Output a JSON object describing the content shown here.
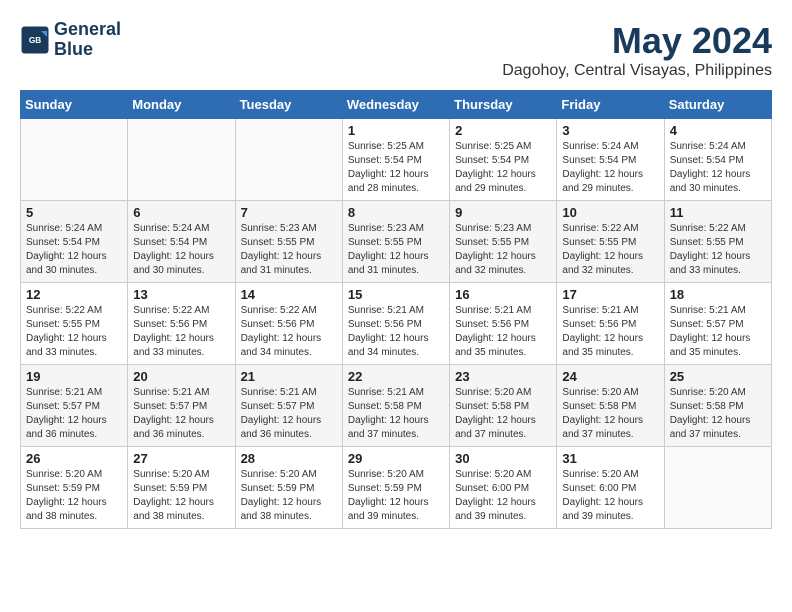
{
  "header": {
    "logo_line1": "General",
    "logo_line2": "Blue",
    "month_title": "May 2024",
    "location": "Dagohoy, Central Visayas, Philippines"
  },
  "weekdays": [
    "Sunday",
    "Monday",
    "Tuesday",
    "Wednesday",
    "Thursday",
    "Friday",
    "Saturday"
  ],
  "weeks": [
    [
      {
        "day": "",
        "sunrise": "",
        "sunset": "",
        "daylight": ""
      },
      {
        "day": "",
        "sunrise": "",
        "sunset": "",
        "daylight": ""
      },
      {
        "day": "",
        "sunrise": "",
        "sunset": "",
        "daylight": ""
      },
      {
        "day": "1",
        "sunrise": "Sunrise: 5:25 AM",
        "sunset": "Sunset: 5:54 PM",
        "daylight": "Daylight: 12 hours and 28 minutes."
      },
      {
        "day": "2",
        "sunrise": "Sunrise: 5:25 AM",
        "sunset": "Sunset: 5:54 PM",
        "daylight": "Daylight: 12 hours and 29 minutes."
      },
      {
        "day": "3",
        "sunrise": "Sunrise: 5:24 AM",
        "sunset": "Sunset: 5:54 PM",
        "daylight": "Daylight: 12 hours and 29 minutes."
      },
      {
        "day": "4",
        "sunrise": "Sunrise: 5:24 AM",
        "sunset": "Sunset: 5:54 PM",
        "daylight": "Daylight: 12 hours and 30 minutes."
      }
    ],
    [
      {
        "day": "5",
        "sunrise": "Sunrise: 5:24 AM",
        "sunset": "Sunset: 5:54 PM",
        "daylight": "Daylight: 12 hours and 30 minutes."
      },
      {
        "day": "6",
        "sunrise": "Sunrise: 5:24 AM",
        "sunset": "Sunset: 5:54 PM",
        "daylight": "Daylight: 12 hours and 30 minutes."
      },
      {
        "day": "7",
        "sunrise": "Sunrise: 5:23 AM",
        "sunset": "Sunset: 5:55 PM",
        "daylight": "Daylight: 12 hours and 31 minutes."
      },
      {
        "day": "8",
        "sunrise": "Sunrise: 5:23 AM",
        "sunset": "Sunset: 5:55 PM",
        "daylight": "Daylight: 12 hours and 31 minutes."
      },
      {
        "day": "9",
        "sunrise": "Sunrise: 5:23 AM",
        "sunset": "Sunset: 5:55 PM",
        "daylight": "Daylight: 12 hours and 32 minutes."
      },
      {
        "day": "10",
        "sunrise": "Sunrise: 5:22 AM",
        "sunset": "Sunset: 5:55 PM",
        "daylight": "Daylight: 12 hours and 32 minutes."
      },
      {
        "day": "11",
        "sunrise": "Sunrise: 5:22 AM",
        "sunset": "Sunset: 5:55 PM",
        "daylight": "Daylight: 12 hours and 33 minutes."
      }
    ],
    [
      {
        "day": "12",
        "sunrise": "Sunrise: 5:22 AM",
        "sunset": "Sunset: 5:55 PM",
        "daylight": "Daylight: 12 hours and 33 minutes."
      },
      {
        "day": "13",
        "sunrise": "Sunrise: 5:22 AM",
        "sunset": "Sunset: 5:56 PM",
        "daylight": "Daylight: 12 hours and 33 minutes."
      },
      {
        "day": "14",
        "sunrise": "Sunrise: 5:22 AM",
        "sunset": "Sunset: 5:56 PM",
        "daylight": "Daylight: 12 hours and 34 minutes."
      },
      {
        "day": "15",
        "sunrise": "Sunrise: 5:21 AM",
        "sunset": "Sunset: 5:56 PM",
        "daylight": "Daylight: 12 hours and 34 minutes."
      },
      {
        "day": "16",
        "sunrise": "Sunrise: 5:21 AM",
        "sunset": "Sunset: 5:56 PM",
        "daylight": "Daylight: 12 hours and 35 minutes."
      },
      {
        "day": "17",
        "sunrise": "Sunrise: 5:21 AM",
        "sunset": "Sunset: 5:56 PM",
        "daylight": "Daylight: 12 hours and 35 minutes."
      },
      {
        "day": "18",
        "sunrise": "Sunrise: 5:21 AM",
        "sunset": "Sunset: 5:57 PM",
        "daylight": "Daylight: 12 hours and 35 minutes."
      }
    ],
    [
      {
        "day": "19",
        "sunrise": "Sunrise: 5:21 AM",
        "sunset": "Sunset: 5:57 PM",
        "daylight": "Daylight: 12 hours and 36 minutes."
      },
      {
        "day": "20",
        "sunrise": "Sunrise: 5:21 AM",
        "sunset": "Sunset: 5:57 PM",
        "daylight": "Daylight: 12 hours and 36 minutes."
      },
      {
        "day": "21",
        "sunrise": "Sunrise: 5:21 AM",
        "sunset": "Sunset: 5:57 PM",
        "daylight": "Daylight: 12 hours and 36 minutes."
      },
      {
        "day": "22",
        "sunrise": "Sunrise: 5:21 AM",
        "sunset": "Sunset: 5:58 PM",
        "daylight": "Daylight: 12 hours and 37 minutes."
      },
      {
        "day": "23",
        "sunrise": "Sunrise: 5:20 AM",
        "sunset": "Sunset: 5:58 PM",
        "daylight": "Daylight: 12 hours and 37 minutes."
      },
      {
        "day": "24",
        "sunrise": "Sunrise: 5:20 AM",
        "sunset": "Sunset: 5:58 PM",
        "daylight": "Daylight: 12 hours and 37 minutes."
      },
      {
        "day": "25",
        "sunrise": "Sunrise: 5:20 AM",
        "sunset": "Sunset: 5:58 PM",
        "daylight": "Daylight: 12 hours and 37 minutes."
      }
    ],
    [
      {
        "day": "26",
        "sunrise": "Sunrise: 5:20 AM",
        "sunset": "Sunset: 5:59 PM",
        "daylight": "Daylight: 12 hours and 38 minutes."
      },
      {
        "day": "27",
        "sunrise": "Sunrise: 5:20 AM",
        "sunset": "Sunset: 5:59 PM",
        "daylight": "Daylight: 12 hours and 38 minutes."
      },
      {
        "day": "28",
        "sunrise": "Sunrise: 5:20 AM",
        "sunset": "Sunset: 5:59 PM",
        "daylight": "Daylight: 12 hours and 38 minutes."
      },
      {
        "day": "29",
        "sunrise": "Sunrise: 5:20 AM",
        "sunset": "Sunset: 5:59 PM",
        "daylight": "Daylight: 12 hours and 39 minutes."
      },
      {
        "day": "30",
        "sunrise": "Sunrise: 5:20 AM",
        "sunset": "Sunset: 6:00 PM",
        "daylight": "Daylight: 12 hours and 39 minutes."
      },
      {
        "day": "31",
        "sunrise": "Sunrise: 5:20 AM",
        "sunset": "Sunset: 6:00 PM",
        "daylight": "Daylight: 12 hours and 39 minutes."
      },
      {
        "day": "",
        "sunrise": "",
        "sunset": "",
        "daylight": ""
      }
    ]
  ]
}
